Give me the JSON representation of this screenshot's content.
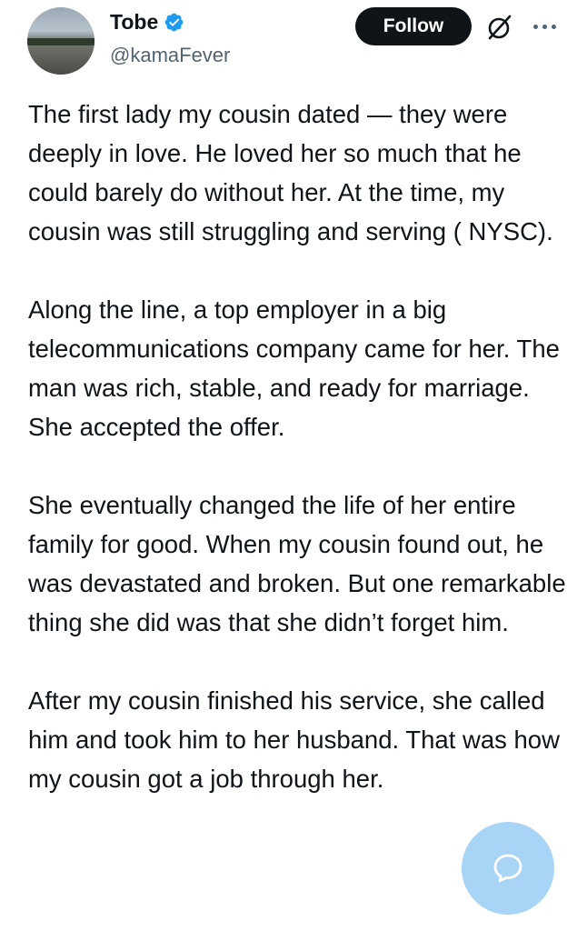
{
  "author": {
    "name": "Tobe",
    "handle": "@kamaFever",
    "verified": true,
    "verified_color": "#1d9bf0"
  },
  "actions": {
    "follow_label": "Follow",
    "grok_icon": "grok-icon",
    "more_icon": "more-options-icon"
  },
  "tweet": {
    "paragraphs": [
      "The first lady my cousin dated — they were deeply in love. He loved her so much that he could barely do without her. At the time, my cousin was still struggling and serving ( NYSC).",
      "Along the line, a top employer in a big telecommunications company came for her. The man was rich, stable, and ready for marriage. She accepted the offer.",
      "She eventually changed the life of her entire family for good. When my cousin found out, he was devastated and broken. But one remarkable thing she did was that she didn’t forget him.",
      "After my cousin finished his service, she called him and took him to her husband. That was how my cousin got a job through her."
    ]
  },
  "fab": {
    "icon": "chat-bubble-icon",
    "color": "#87c4f2"
  }
}
